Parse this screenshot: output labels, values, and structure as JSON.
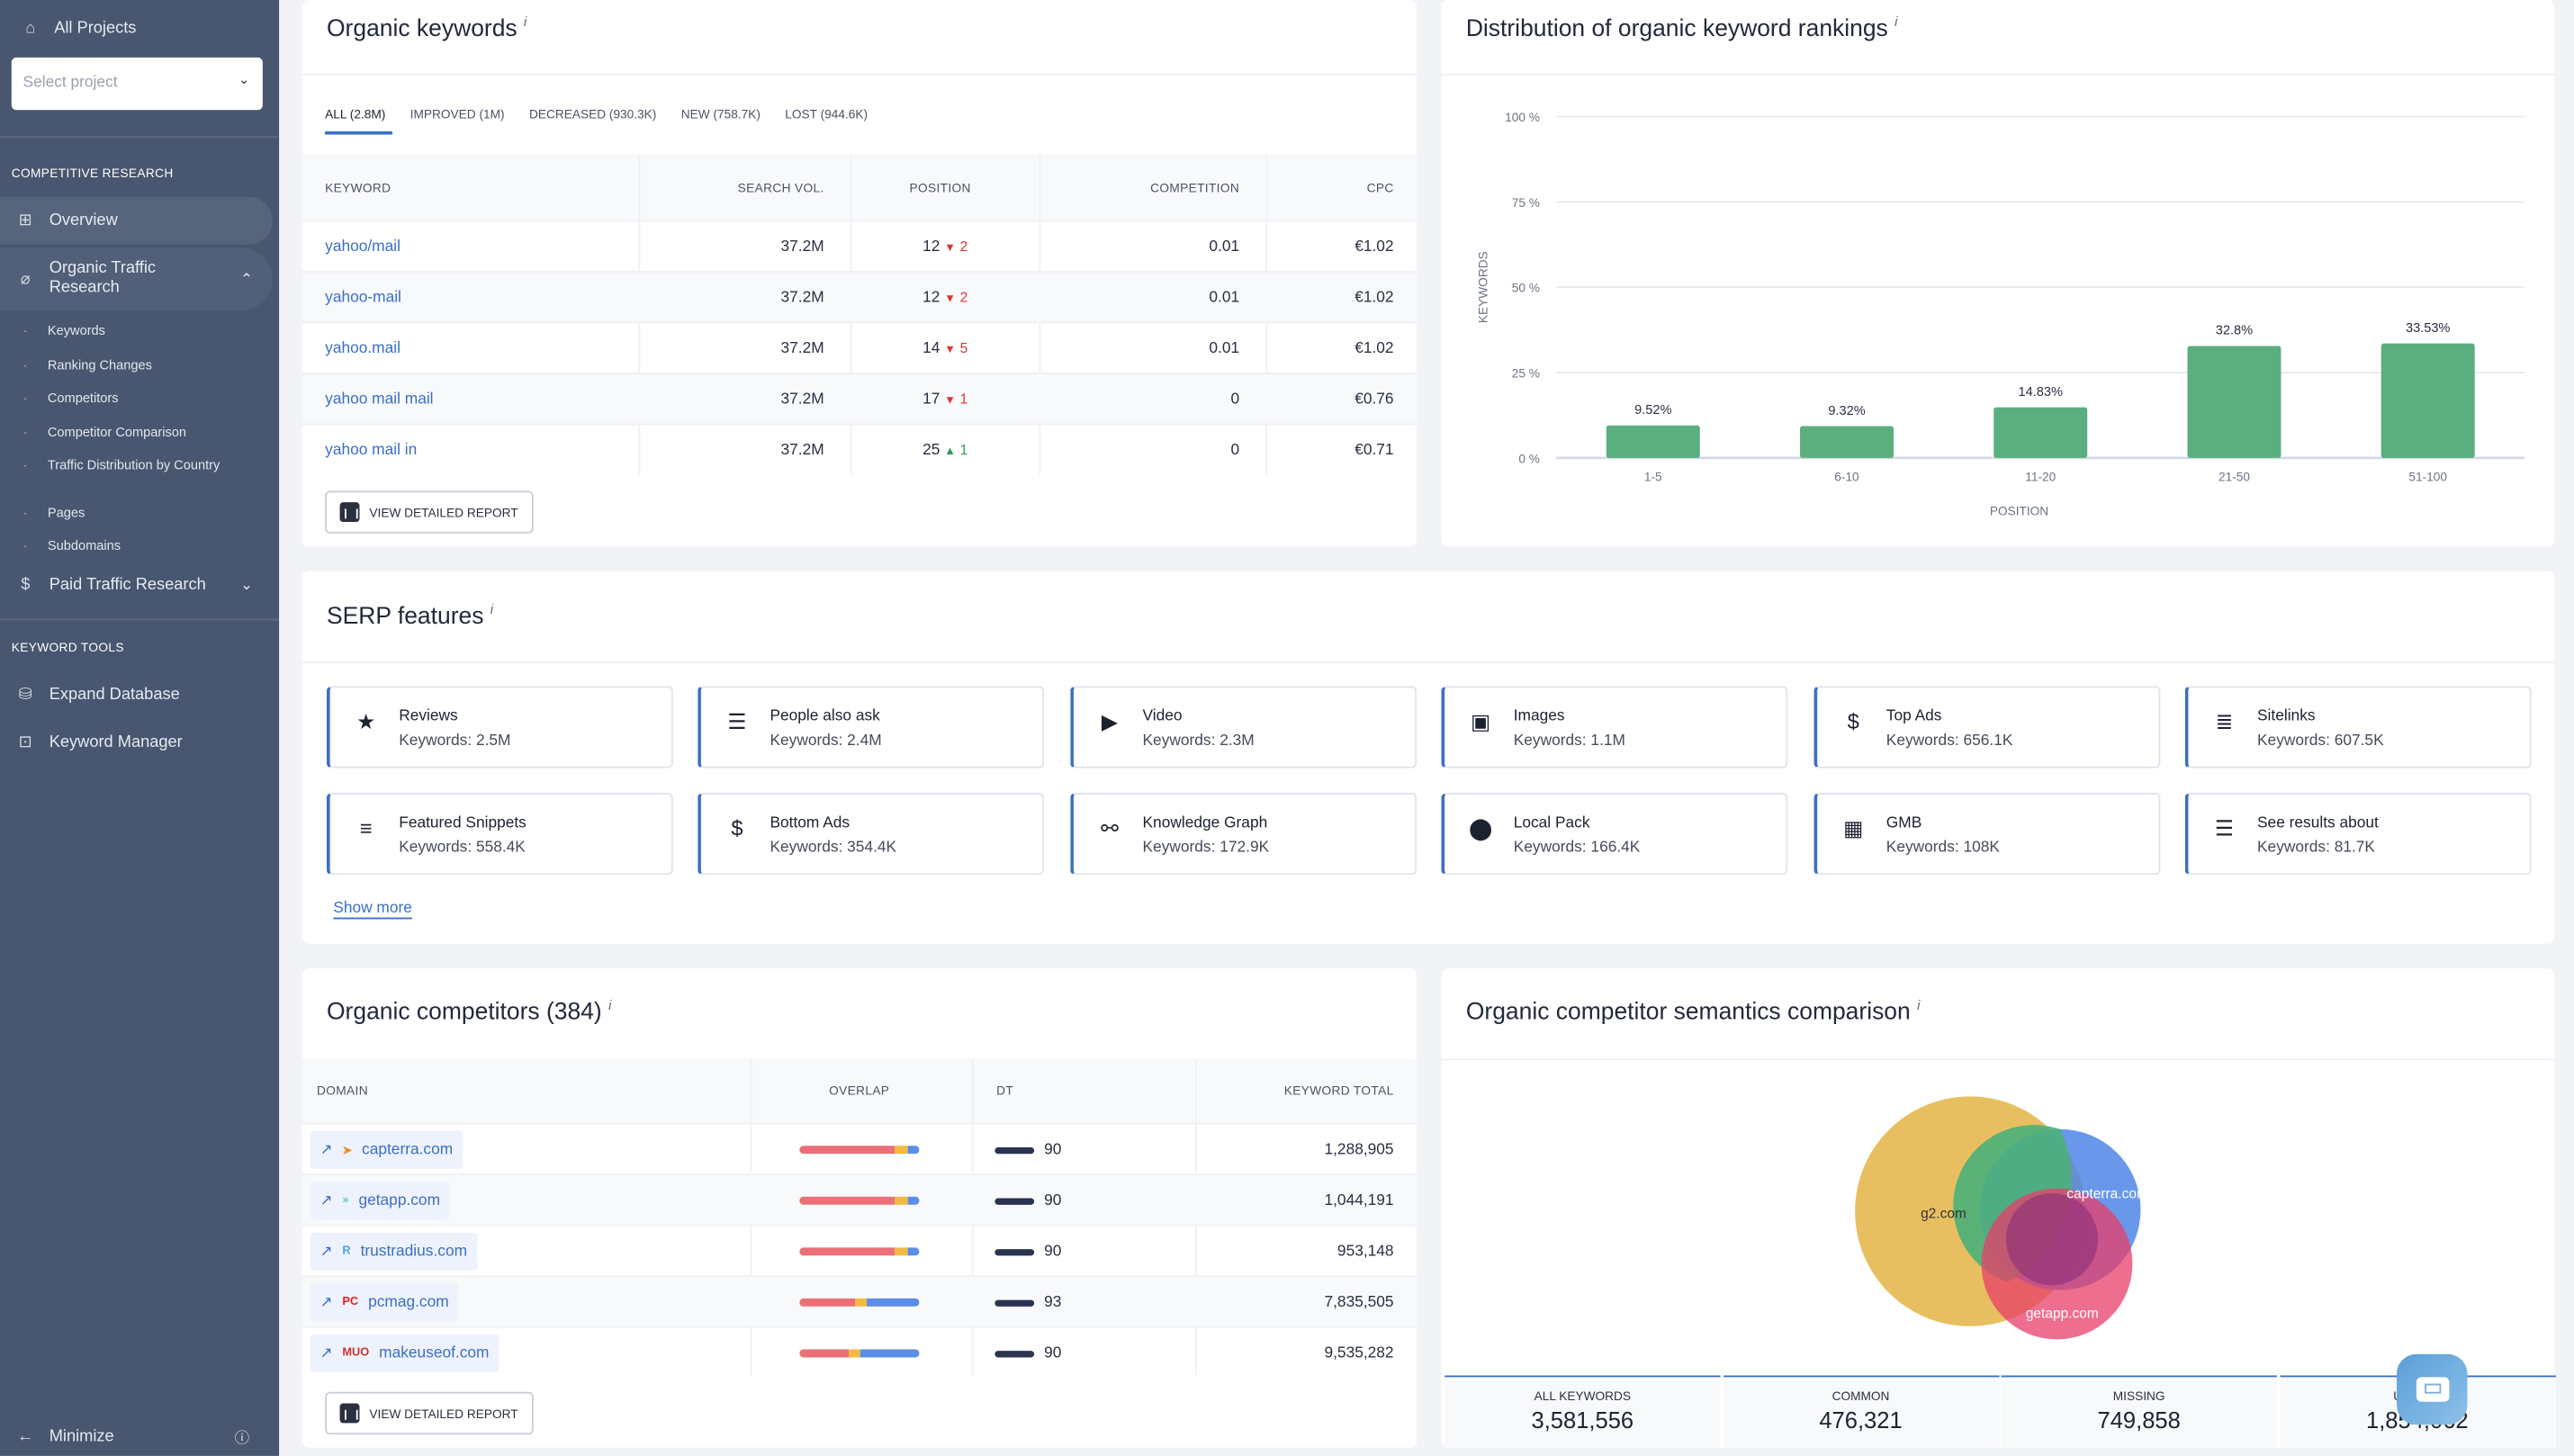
{
  "sidebar": {
    "all_projects": "All Projects",
    "select_placeholder": "Select project",
    "section_competitive": "COMPETITIVE RESEARCH",
    "overview": "Overview",
    "organic": "Organic Traffic Research",
    "organic_sub": [
      "Keywords",
      "Ranking Changes",
      "Competitors",
      "Competitor Comparison",
      "Traffic Distribution by Country",
      "Pages",
      "Subdomains"
    ],
    "paid": "Paid Traffic Research",
    "section_tools": "KEYWORD TOOLS",
    "expand_db": "Expand Database",
    "kw_manager": "Keyword Manager",
    "minimize": "Minimize"
  },
  "organic_keywords": {
    "title": "Organic keywords",
    "info": "i",
    "tabs": [
      "ALL (2.8M)",
      "IMPROVED (1M)",
      "DECREASED (930.3K)",
      "NEW (758.7K)",
      "LOST (944.6K)"
    ],
    "columns": [
      "KEYWORD",
      "SEARCH VOL.",
      "POSITION",
      "COMPETITION",
      "CPC"
    ],
    "rows": [
      {
        "keyword": "yahoo/mail",
        "vol": "37.2M",
        "pos": "12",
        "dir": "down",
        "change": "2",
        "comp": "0.01",
        "cpc": "€1.02"
      },
      {
        "keyword": "yahoo-mail",
        "vol": "37.2M",
        "pos": "12",
        "dir": "down",
        "change": "2",
        "comp": "0.01",
        "cpc": "€1.02"
      },
      {
        "keyword": "yahoo.mail",
        "vol": "37.2M",
        "pos": "14",
        "dir": "down",
        "change": "5",
        "comp": "0.01",
        "cpc": "€1.02"
      },
      {
        "keyword": "yahoo mail mail",
        "vol": "37.2M",
        "pos": "17",
        "dir": "down",
        "change": "1",
        "comp": "0",
        "cpc": "€0.76"
      },
      {
        "keyword": "yahoo mail in",
        "vol": "37.2M",
        "pos": "25",
        "dir": "up",
        "change": "1",
        "comp": "0",
        "cpc": "€0.71"
      }
    ],
    "report_button": "VIEW DETAILED REPORT"
  },
  "chart_data": {
    "type": "bar",
    "title": "Distribution of organic keyword rankings",
    "info": "i",
    "categories": [
      "1-5",
      "6-10",
      "11-20",
      "21-50",
      "51-100"
    ],
    "values": [
      9.52,
      9.32,
      14.83,
      32.8,
      33.53
    ],
    "data_labels": [
      "9.52%",
      "9.32%",
      "14.83%",
      "32.8%",
      "33.53%"
    ],
    "xlabel": "POSITION",
    "ylabel": "KEYWORDS",
    "ylim": [
      0,
      100
    ],
    "yticks": [
      "0 %",
      "25 %",
      "50 %",
      "75 %",
      "100 %"
    ],
    "grid": true,
    "color": "#5baf7f"
  },
  "serp": {
    "title": "SERP features",
    "info": "i",
    "show_more": "Show more",
    "tiles": [
      {
        "name": "Reviews",
        "kw": "Keywords: 2.5M",
        "icon": "★"
      },
      {
        "name": "People also ask",
        "kw": "Keywords: 2.4M",
        "icon": "☰"
      },
      {
        "name": "Video",
        "kw": "Keywords: 2.3M",
        "icon": "▶"
      },
      {
        "name": "Images",
        "kw": "Keywords: 1.1M",
        "icon": "▣"
      },
      {
        "name": "Top Ads",
        "kw": "Keywords: 656.1K",
        "icon": "$"
      },
      {
        "name": "Sitelinks",
        "kw": "Keywords: 607.5K",
        "icon": "≣"
      },
      {
        "name": "Featured Snippets",
        "kw": "Keywords: 558.4K",
        "icon": "≡"
      },
      {
        "name": "Bottom Ads",
        "kw": "Keywords: 354.4K",
        "icon": "$"
      },
      {
        "name": "Knowledge Graph",
        "kw": "Keywords: 172.9K",
        "icon": "⚯"
      },
      {
        "name": "Local Pack",
        "kw": "Keywords: 166.4K",
        "icon": "⬤"
      },
      {
        "name": "GMB",
        "kw": "Keywords: 108K",
        "icon": "▦"
      },
      {
        "name": "See results about",
        "kw": "Keywords: 81.7K",
        "icon": "☰"
      }
    ]
  },
  "competitors": {
    "title": "Organic competitors (384)",
    "info": "i",
    "columns": [
      "DOMAIN",
      "OVERLAP",
      "DT",
      "KEYWORD TOTAL"
    ],
    "rows": [
      {
        "domain": "capterra.com",
        "overlap": [
          0.8,
          0.1,
          0.1
        ],
        "dt": "90",
        "total": "1,288,905",
        "fav": "➤",
        "favcolor": "#f08a24"
      },
      {
        "domain": "getapp.com",
        "overlap": [
          0.8,
          0.1,
          0.1
        ],
        "dt": "90",
        "total": "1,044,191",
        "fav": "»",
        "favcolor": "#5cc8c0"
      },
      {
        "domain": "trustradius.com",
        "overlap": [
          0.8,
          0.1,
          0.1
        ],
        "dt": "90",
        "total": "953,148",
        "fav": "R",
        "favcolor": "#4aa3e8"
      },
      {
        "domain": "pcmag.com",
        "overlap": [
          0.46,
          0.1,
          0.44
        ],
        "dt": "93",
        "total": "7,835,505",
        "fav": "PC",
        "favcolor": "#d22"
      },
      {
        "domain": "makeuseof.com",
        "overlap": [
          0.41,
          0.1,
          0.49
        ],
        "dt": "90",
        "total": "9,535,282",
        "fav": "MUO",
        "favcolor": "#c33"
      }
    ],
    "overlap_colors": [
      "#ec6f77",
      "#f4b942",
      "#5b8ee6"
    ],
    "report_button": "VIEW DETAILED REPORT"
  },
  "semantics": {
    "title": "Organic competitor semantics comparison",
    "info": "i",
    "venn": [
      "g2.com",
      "capterra.com",
      "getapp.com"
    ],
    "stats": [
      {
        "label": "ALL KEYWORDS",
        "value": "3,581,556"
      },
      {
        "label": "COMMON",
        "value": "476,321"
      },
      {
        "label": "MISSING",
        "value": "749,858"
      },
      {
        "label": "UNIQUE",
        "value": "1,854,062"
      }
    ]
  }
}
